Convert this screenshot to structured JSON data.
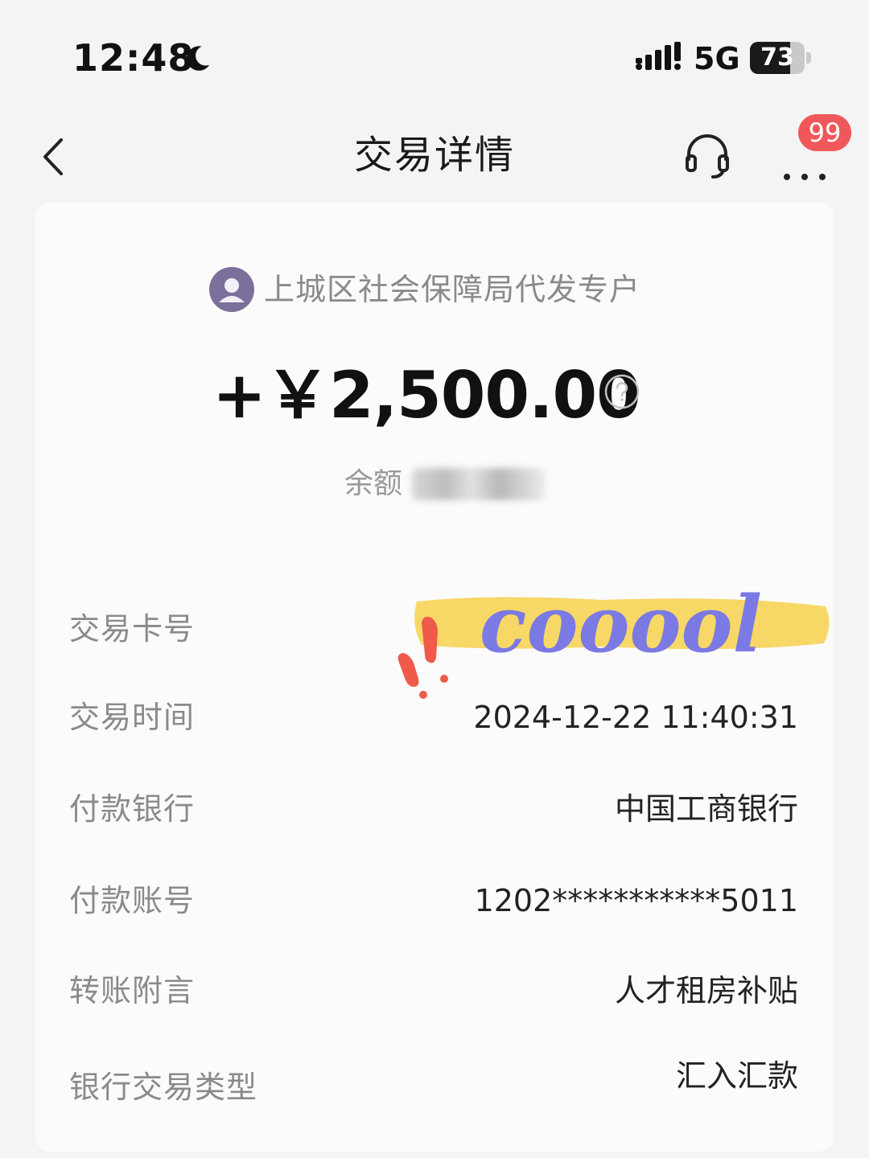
{
  "status_bar": {
    "time": "12:48",
    "network": "5G",
    "battery_level": "73",
    "battery_fraction": 0.73
  },
  "nav": {
    "title": "交易详情",
    "badge_count": "99",
    "back_icon": "chevron-left-icon",
    "support_icon": "headset-icon",
    "more_icon": "more-dots-icon"
  },
  "transaction": {
    "payer_name": "上城区社会保障局代发专户",
    "amount": "+￥2,500.00",
    "balance_label": "余额"
  },
  "details": [
    {
      "label": "交易卡号",
      "value": ""
    },
    {
      "label": "交易时间",
      "value": "2024-12-22 11:40:31"
    },
    {
      "label": "付款银行",
      "value": "中国工商银行"
    },
    {
      "label": "付款账号",
      "value": "1202***********5011"
    },
    {
      "label": "转账附言",
      "value": "人才租房补贴"
    },
    {
      "label": "银行交易类型",
      "value": "汇入汇款"
    }
  ],
  "sticker": {
    "text": "cooool",
    "highlight_color": "#f7d867",
    "text_color": "#7b79e3",
    "exclaim_color": "#ef5a4a"
  }
}
